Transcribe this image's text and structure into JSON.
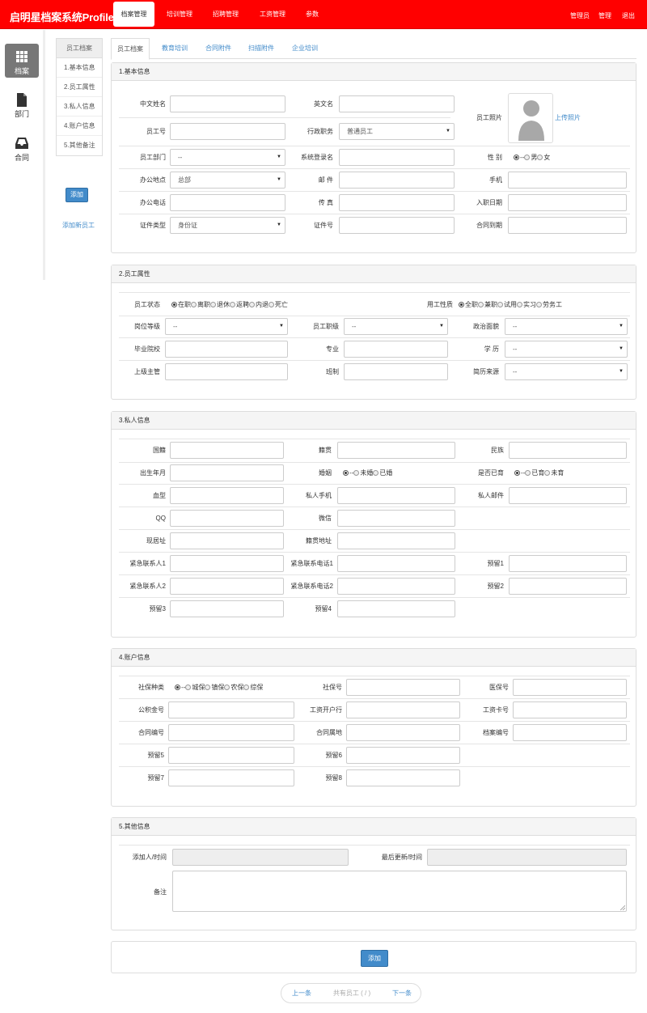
{
  "app": {
    "title": "启明星档案系统Profile"
  },
  "topnav": [
    {
      "label": "档案管理",
      "active": true
    },
    {
      "label": "培训管理"
    },
    {
      "label": "招聘管理"
    },
    {
      "label": "工资管理"
    },
    {
      "label": "参数"
    }
  ],
  "topright": {
    "admin": "管理员",
    "manage": "管理",
    "logout": "退出"
  },
  "leftnav": [
    {
      "label": "档案",
      "icon": "grid-icon"
    },
    {
      "label": "部门",
      "icon": "document-icon"
    },
    {
      "label": "合同",
      "icon": "inbox-icon"
    }
  ],
  "subnav": {
    "header": "员工档案",
    "items": [
      "1.基本信息",
      "2.员工属性",
      "3.私人信息",
      "4.账户信息",
      "5.其他备注"
    ]
  },
  "side": {
    "add_button": "添加",
    "add_new_link": "添加新员工"
  },
  "tabs": [
    "员工档案",
    "教育培训",
    "合同附件",
    "扫描附件",
    "企业培训"
  ],
  "basic": {
    "title": "1.基本信息",
    "labels": {
      "cn_name": "中文姓名",
      "en_name": "英文名",
      "photo": "员工照片",
      "emp_no": "员工号",
      "admin_role": "行政职务",
      "dept": "员工部门",
      "login": "系统登录名",
      "gender": "性 别",
      "office": "办公地点",
      "email": "邮 件",
      "mobile": "手机",
      "office_tel": "办公电话",
      "fax": "传 真",
      "join_date": "入职日期",
      "id_type": "证件类型",
      "id_no": "证件号",
      "contract_due": "合同到期"
    },
    "values": {
      "admin_role": "普通员工",
      "dept": "--",
      "office": "总部",
      "id_type": "身份证"
    },
    "upload_link": "上传照片",
    "gender_options": [
      "--",
      "男",
      "女"
    ]
  },
  "attrs": {
    "title": "2.员工属性",
    "labels": {
      "status": "员工状态",
      "emp_type": "用工性质",
      "post_level": "岗位等级",
      "rank": "员工职级",
      "politics": "政治面貌",
      "school": "毕业院校",
      "major": "专业",
      "education": "学 历",
      "supervisor": "上级主管",
      "class": "班制",
      "resume_source": "简历来源"
    },
    "status_options": [
      "在职",
      "离职",
      "退休",
      "返聘",
      "内退",
      "死亡"
    ],
    "type_options": [
      "全职",
      "兼职",
      "试用",
      "实习",
      "劳务工"
    ],
    "values": {
      "post_level": "--",
      "rank": "--",
      "politics": "--",
      "education": "--",
      "resume_source": "--"
    }
  },
  "private": {
    "title": "3.私人信息",
    "labels": {
      "nationality": "国籍",
      "native": "籍贯",
      "ethnic": "民族",
      "birth": "出生年月",
      "marital": "婚姻",
      "childbirth": "是否已育",
      "blood": "血型",
      "private_mobile": "私人手机",
      "private_email": "私人邮件",
      "qq": "QQ",
      "wechat": "微信",
      "address": "现居址",
      "native_addr": "籍贯地址",
      "contact1": "紧急联系人1",
      "contact_tel1": "紧急联系电话1",
      "reserve1": "预留1",
      "contact2": "紧急联系人2",
      "contact_tel2": "紧急联系电话2",
      "reserve2": "预留2",
      "reserve3": "预留3",
      "reserve4": "预留4"
    },
    "marital_options": [
      "--",
      "未婚",
      "已婚"
    ],
    "child_options": [
      "--",
      "已育",
      "未育"
    ]
  },
  "account": {
    "title": "4.账户信息",
    "labels": {
      "ss_type": "社保种类",
      "ss_no": "社保号",
      "medical": "医保号",
      "fund": "公积金号",
      "bank": "工资开户行",
      "salary_card": "工资卡号",
      "contract_no": "合同编号",
      "contract_place": "合同属地",
      "archive_no": "档案编号",
      "reserve5": "预留5",
      "reserve6": "预留6",
      "reserve7": "预留7",
      "reserve8": "预留8"
    },
    "ss_options": [
      "--",
      "城保",
      "镇保",
      "农保",
      "综保"
    ]
  },
  "other": {
    "title": "5.其他信息",
    "labels": {
      "added": "添加人/时间",
      "updated": "最后更新/时间",
      "remark": "备注"
    }
  },
  "bottom": {
    "submit": "添加"
  },
  "pager": {
    "prev": "上一条",
    "total": "共有员工 ( / )",
    "next": "下一条"
  }
}
